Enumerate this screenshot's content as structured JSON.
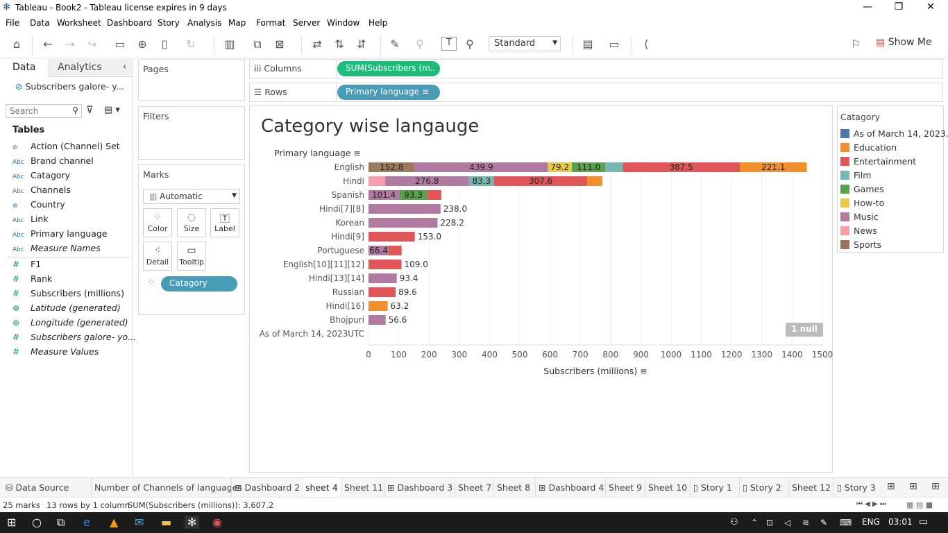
{
  "window": {
    "title": "Tableau - Book2 - Tableau license expires in 9 days"
  },
  "menu": [
    "File",
    "Data",
    "Worksheet",
    "Dashboard",
    "Story",
    "Analysis",
    "Map",
    "Format",
    "Server",
    "Window",
    "Help"
  ],
  "toolbar": {
    "fit": "Standard",
    "show_me": "Show Me"
  },
  "left_pane": {
    "tabs": [
      "Data",
      "Analytics"
    ],
    "datasource": "Subscribers galore- y...",
    "search_placeholder": "Search",
    "tables_heading": "Tables",
    "dimensions": [
      {
        "icon": "set",
        "label": "Action (Channel) Set"
      },
      {
        "icon": "abc",
        "label": "Brand channel"
      },
      {
        "icon": "abc",
        "label": "Catagory"
      },
      {
        "icon": "abc",
        "label": "Channels"
      },
      {
        "icon": "globe",
        "label": "Country"
      },
      {
        "icon": "abc",
        "label": "Link"
      },
      {
        "icon": "abc",
        "label": "Primary language"
      },
      {
        "icon": "abc",
        "label": "Measure Names"
      }
    ],
    "measures": [
      {
        "icon": "hash",
        "label": "F1"
      },
      {
        "icon": "hash",
        "label": "Rank"
      },
      {
        "icon": "hash",
        "label": "Subscribers (millions)"
      },
      {
        "icon": "globe",
        "label": "Latitude (generated)"
      },
      {
        "icon": "globe",
        "label": "Longitude (generated)"
      },
      {
        "icon": "hash",
        "label": "Subscribers galore- yo..."
      },
      {
        "icon": "hash",
        "label": "Measure Values"
      }
    ]
  },
  "cards": {
    "pages": "Pages",
    "filters": "Filters",
    "marks": "Marks",
    "mark_type": "Automatic",
    "mark_buttons": [
      "Color",
      "Size",
      "Label",
      "Detail",
      "Tooltip"
    ],
    "color_pill": "Catagory"
  },
  "shelves": {
    "columns_label": "Columns",
    "columns_pill": "SUM(Subscribers (m..",
    "rows_label": "Rows",
    "rows_pill": "Primary language"
  },
  "view": {
    "title": "Category wise langauge",
    "null_badge": "1 null"
  },
  "chart_data": {
    "type": "bar",
    "orientation": "horizontal-stacked",
    "title": "Category wise langauge",
    "row_header": "Primary language",
    "xlabel": "Subscribers (millions)",
    "xlim": [
      0,
      1500
    ],
    "xticks": [
      0,
      100,
      200,
      300,
      400,
      500,
      600,
      700,
      800,
      900,
      1000,
      1100,
      1200,
      1300,
      1400,
      1500
    ],
    "categories": [
      "English",
      "Hindi",
      "Spanish",
      "Hindi[7][8]",
      "Korean",
      "Hindi[9]",
      "Portuguese",
      "English[10][11][12]",
      "Hindi[13][14]",
      "Russian",
      "Hindi[16]",
      "Bhojpuri",
      "As of March 14, 2023UTC"
    ],
    "series": [
      {
        "name": "Sports",
        "color": "#9c7a5e",
        "values": [
          152.8,
          0,
          0,
          0,
          0,
          0,
          0,
          0,
          0,
          0,
          0,
          0,
          0
        ]
      },
      {
        "name": "News",
        "color": "#f89db0",
        "values": [
          0,
          55,
          0,
          0,
          0,
          0,
          0,
          0,
          0,
          0,
          0,
          0,
          0
        ]
      },
      {
        "name": "Music",
        "color": "#b07aa1",
        "values": [
          439.9,
          276.8,
          101.4,
          238.0,
          228.2,
          0,
          66.4,
          0,
          93.4,
          0,
          0,
          56.6,
          0
        ]
      },
      {
        "name": "How-to",
        "color": "#edc948",
        "values": [
          79.2,
          0,
          0,
          0,
          0,
          0,
          0,
          0,
          0,
          0,
          0,
          0,
          0
        ]
      },
      {
        "name": "Games",
        "color": "#59a14f",
        "values": [
          111.0,
          0,
          93.3,
          0,
          0,
          0,
          0,
          0,
          0,
          0,
          0,
          0,
          0
        ]
      },
      {
        "name": "Film",
        "color": "#76b7b2",
        "values": [
          57,
          83.3,
          0,
          0,
          0,
          0,
          0,
          0,
          0,
          0,
          0,
          0,
          0
        ]
      },
      {
        "name": "Entertainment",
        "color": "#e15759",
        "values": [
          387.5,
          307.6,
          46,
          0,
          0,
          153.0,
          43,
          109.0,
          0,
          89.6,
          0,
          0,
          0
        ]
      },
      {
        "name": "Education",
        "color": "#f28e2b",
        "values": [
          221.1,
          50,
          0,
          0,
          0,
          0,
          0,
          0,
          0,
          0,
          63.2,
          0,
          0
        ]
      }
    ],
    "bar_labels": [
      [
        "152.8",
        null,
        "439.9",
        "79.2",
        "111.0",
        null,
        "387.5",
        "221.1"
      ],
      [
        null,
        null,
        "276.8",
        null,
        null,
        "83.3",
        "307.6",
        null
      ],
      [
        null,
        null,
        "101.4",
        null,
        "93.3",
        null,
        null,
        null
      ],
      [
        "238.0"
      ],
      [
        "228.2"
      ],
      [
        "153.0"
      ],
      [
        null,
        null,
        "66.4",
        null,
        null,
        null,
        null,
        null
      ],
      [
        "109.0"
      ],
      [
        "93.4"
      ],
      [
        "89.6"
      ],
      [
        "63.2"
      ],
      [
        "56.6"
      ],
      []
    ]
  },
  "legend": {
    "title": "Catagory",
    "items": [
      {
        "label": "As of March 14, 2023..",
        "color": "#4e79a7"
      },
      {
        "label": "Education",
        "color": "#f28e2b"
      },
      {
        "label": "Entertainment",
        "color": "#e15759"
      },
      {
        "label": "Film",
        "color": "#76b7b2"
      },
      {
        "label": "Games",
        "color": "#59a14f"
      },
      {
        "label": "How-to",
        "color": "#edc948"
      },
      {
        "label": "Music",
        "color": "#b07aa1"
      },
      {
        "label": "News",
        "color": "#ff9da7"
      },
      {
        "label": "Sports",
        "color": "#9c755f"
      }
    ]
  },
  "sheet_tabs": [
    {
      "icon": "db",
      "label": "Data Source"
    },
    {
      "icon": "",
      "label": "Number of Channels of languages"
    },
    {
      "icon": "dash",
      "label": "Dashboard 2"
    },
    {
      "icon": "",
      "label": "sheet 4",
      "active": true
    },
    {
      "icon": "",
      "label": "Sheet 11"
    },
    {
      "icon": "dash",
      "label": "Dashboard 3"
    },
    {
      "icon": "",
      "label": "Sheet 7"
    },
    {
      "icon": "",
      "label": "Sheet 8"
    },
    {
      "icon": "dash",
      "label": "Dashboard 4"
    },
    {
      "icon": "",
      "label": "Sheet 9"
    },
    {
      "icon": "",
      "label": "Sheet 10"
    },
    {
      "icon": "story",
      "label": "Story 1"
    },
    {
      "icon": "story",
      "label": "Story 2"
    },
    {
      "icon": "",
      "label": "Sheet 12"
    },
    {
      "icon": "story",
      "label": "Story 3"
    }
  ],
  "status": {
    "marks": "25 marks",
    "rows": "13 rows by 1 column",
    "sum": "SUM(Subscribers (millions)): 3.607.2"
  },
  "taskbar": {
    "lang": "ENG",
    "time": "03:01"
  }
}
